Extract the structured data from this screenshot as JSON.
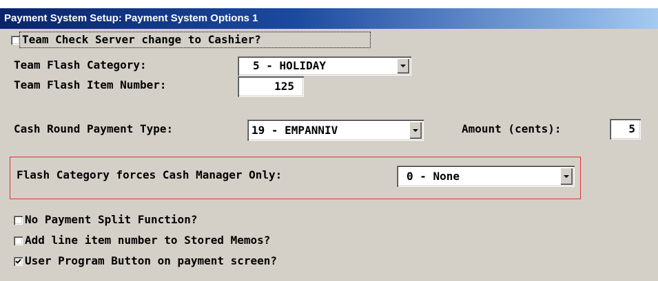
{
  "window": {
    "title": "Payment System Setup: Payment System Options 1"
  },
  "options": {
    "team_check_server": {
      "label": "Team Check Server change to Cashier?",
      "checked": false
    },
    "team_flash_category": {
      "label": "Team Flash Category:",
      "value": "5 - HOLIDAY"
    },
    "team_flash_item_number": {
      "label": "Team Flash Item Number:",
      "value": "125"
    },
    "cash_round_payment_type": {
      "label": "Cash Round Payment Type:",
      "value": "19 - EMPANNIV"
    },
    "amount_cents": {
      "label": "Amount (cents):",
      "value": "5"
    },
    "flash_category_forces": {
      "label": "Flash Category forces Cash Manager Only:",
      "value": "0 - None"
    },
    "no_payment_split": {
      "label": "No Payment Split Function?",
      "checked": false
    },
    "add_line_item_number": {
      "label": "Add line item number to Stored Memos?",
      "checked": false
    },
    "user_program_button": {
      "label": "User Program Button on payment screen?",
      "checked": true
    }
  },
  "icons": {
    "dropdown": "chevron-down-icon",
    "check": "checkmark-icon"
  }
}
